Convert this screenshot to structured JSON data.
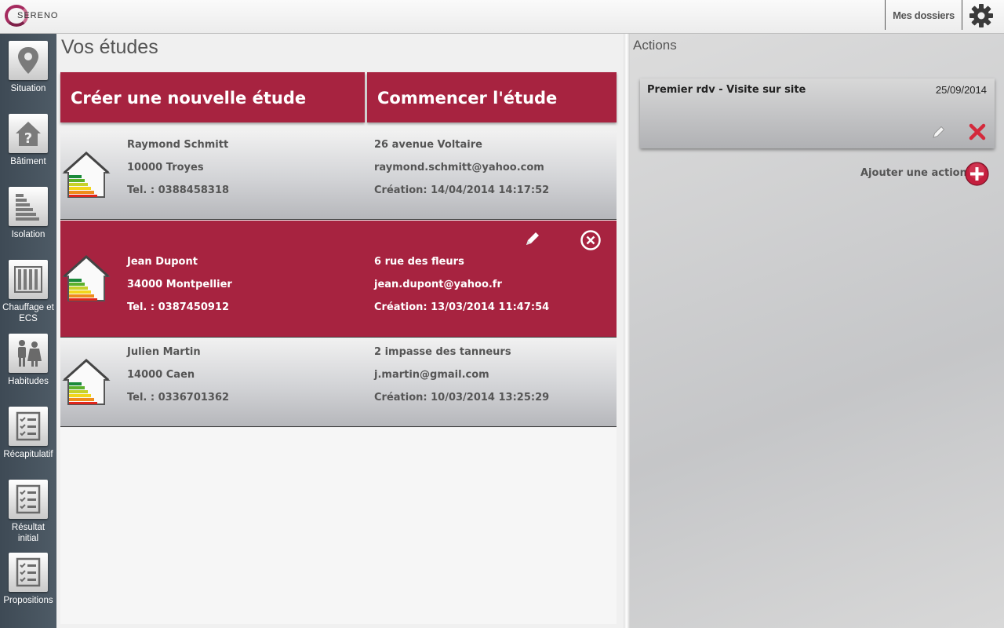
{
  "app": {
    "logo_text": "SERENO"
  },
  "topbar": {
    "mes_dossiers": "Mes dossiers"
  },
  "sidebar": {
    "items": [
      {
        "label": "Situation",
        "icon": "map-pin-icon"
      },
      {
        "label": "Bâtiment",
        "icon": "house-question-icon"
      },
      {
        "label": "Isolation",
        "icon": "energy-bars-icon"
      },
      {
        "label": "Chauffage et ECS",
        "icon": "radiator-icon"
      },
      {
        "label": "Habitudes",
        "icon": "people-icon"
      },
      {
        "label": "Récapitulatif",
        "icon": "checklist-icon"
      },
      {
        "label": "Résultat initial",
        "icon": "checklist-icon"
      },
      {
        "label": "Propositions",
        "icon": "checklist-icon"
      }
    ]
  },
  "main": {
    "title": "Vos études",
    "create_button": "Créer une nouvelle étude",
    "start_button": "Commencer l'étude",
    "studies": [
      {
        "name": "Raymond Schmitt",
        "city": "10000 Troyes",
        "phone": "Tel. : 0388458318",
        "address": "26 avenue Voltaire",
        "email": "raymond.schmitt@yahoo.com",
        "created": "Création: 14/04/2014 14:17:52",
        "selected": false
      },
      {
        "name": "Jean Dupont",
        "city": "34000 Montpellier",
        "phone": "Tel. : 0387450912",
        "address": "6 rue des fleurs",
        "email": "jean.dupont@yahoo.fr",
        "created": "Création: 13/03/2014 11:47:54",
        "selected": true
      },
      {
        "name": "Julien Martin",
        "city": "14000 Caen",
        "phone": "Tel. : 0336701362",
        "address": "2 impasse des tanneurs",
        "email": "j.martin@gmail.com",
        "created": "Création: 10/03/2014 13:25:29",
        "selected": false
      }
    ]
  },
  "actions_panel": {
    "title": "Actions",
    "items": [
      {
        "title": "Premier rdv - Visite sur site",
        "date": "25/09/2014"
      }
    ],
    "add_label": "Ajouter une action"
  },
  "colors": {
    "accent": "#a72340",
    "sidebar": "#46525d"
  }
}
